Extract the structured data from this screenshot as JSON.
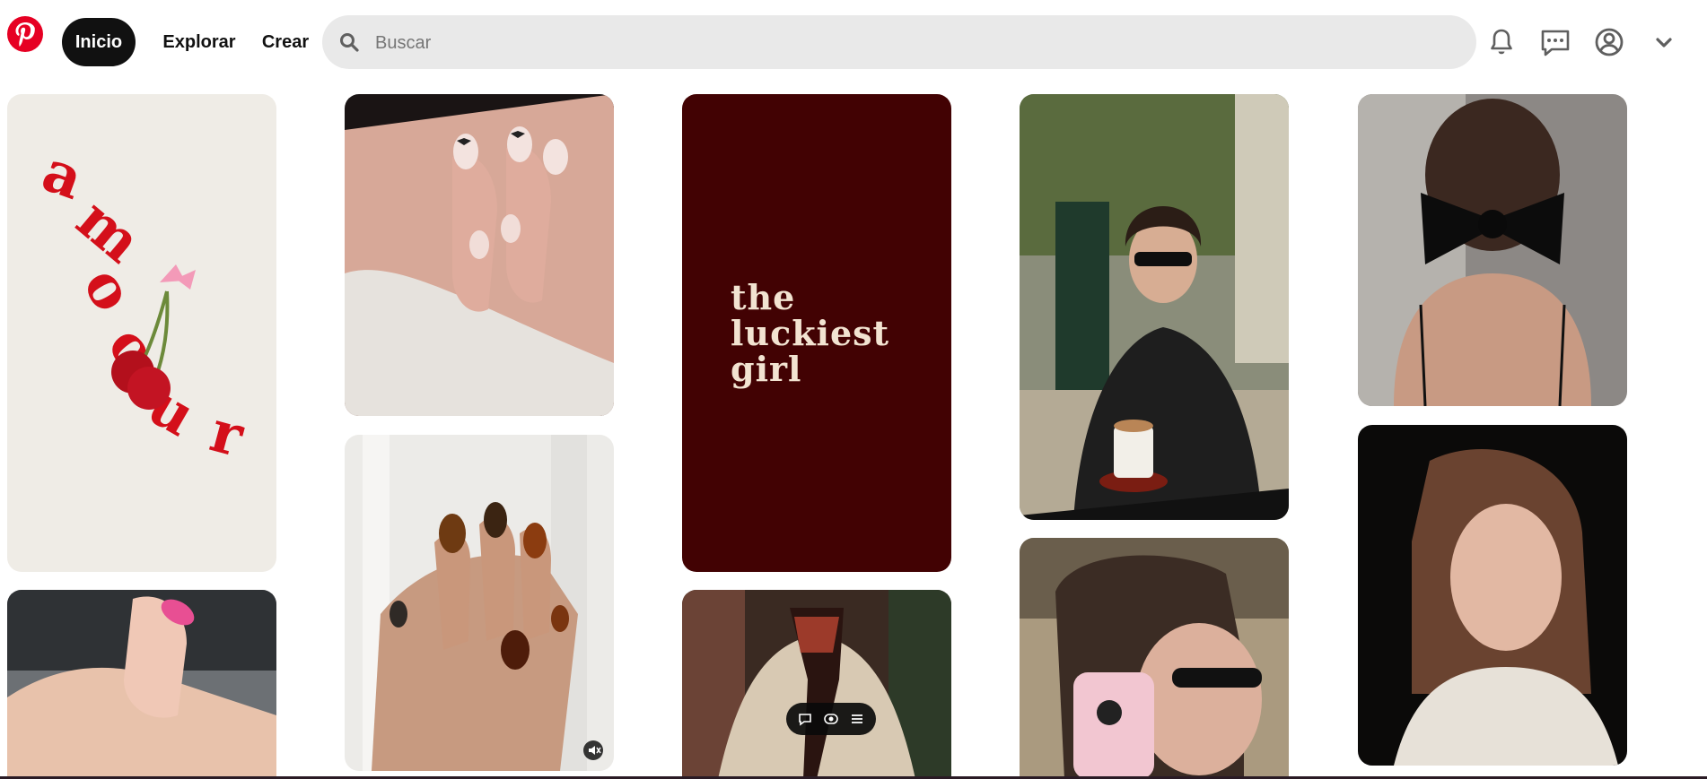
{
  "header": {
    "nav": {
      "home_label": "Inicio",
      "explore_label": "Explorar",
      "create_label": "Crear"
    },
    "search": {
      "placeholder": "Buscar",
      "value": ""
    },
    "icons": [
      "notifications-icon",
      "messages-icon",
      "profile-icon",
      "chevron-down-icon"
    ]
  },
  "pins": {
    "amour": {
      "text": "amour"
    },
    "luckiest": {
      "text": "the\nluckiest\ngirl"
    }
  },
  "colors": {
    "brand": "#e60023",
    "nav_active_bg": "#111111",
    "search_bg": "#e9e9e9",
    "luckiest_bg": "#420203",
    "luckiest_text": "#f2e3d1"
  }
}
